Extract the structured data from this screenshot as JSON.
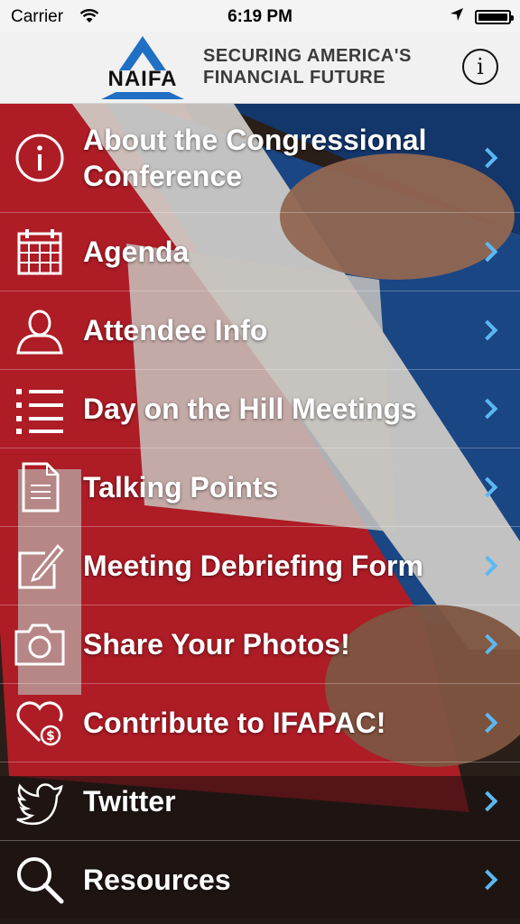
{
  "status_bar": {
    "carrier": "Carrier",
    "time": "6:19 PM",
    "wifi_icon": "wifi-icon",
    "location_icon": "location-arrow-icon",
    "battery_icon": "battery-icon"
  },
  "header": {
    "logo_text": "NAIFA",
    "tagline_line1": "SECURING AMERICA'S",
    "tagline_line2": "FINANCIAL FUTURE",
    "info_glyph": "i"
  },
  "menu": {
    "items": [
      {
        "label": "About the Congressional Conference",
        "icon": "info-circle-icon"
      },
      {
        "label": "Agenda",
        "icon": "calendar-icon"
      },
      {
        "label": "Attendee Info",
        "icon": "person-icon"
      },
      {
        "label": "Day on the Hill Meetings",
        "icon": "list-icon"
      },
      {
        "label": "Talking Points",
        "icon": "document-icon"
      },
      {
        "label": "Meeting Debriefing Form",
        "icon": "edit-form-icon"
      },
      {
        "label": "Share Your Photos!",
        "icon": "camera-icon"
      },
      {
        "label": "Contribute to IFAPAC!",
        "icon": "heart-dollar-icon"
      },
      {
        "label": "Twitter",
        "icon": "twitter-bird-icon"
      },
      {
        "label": "Resources",
        "icon": "search-icon"
      }
    ]
  },
  "colors": {
    "chevron": "#5cb8f2",
    "brand_blue": "#1f6fc4",
    "header_bg": "#f1f1f1"
  }
}
